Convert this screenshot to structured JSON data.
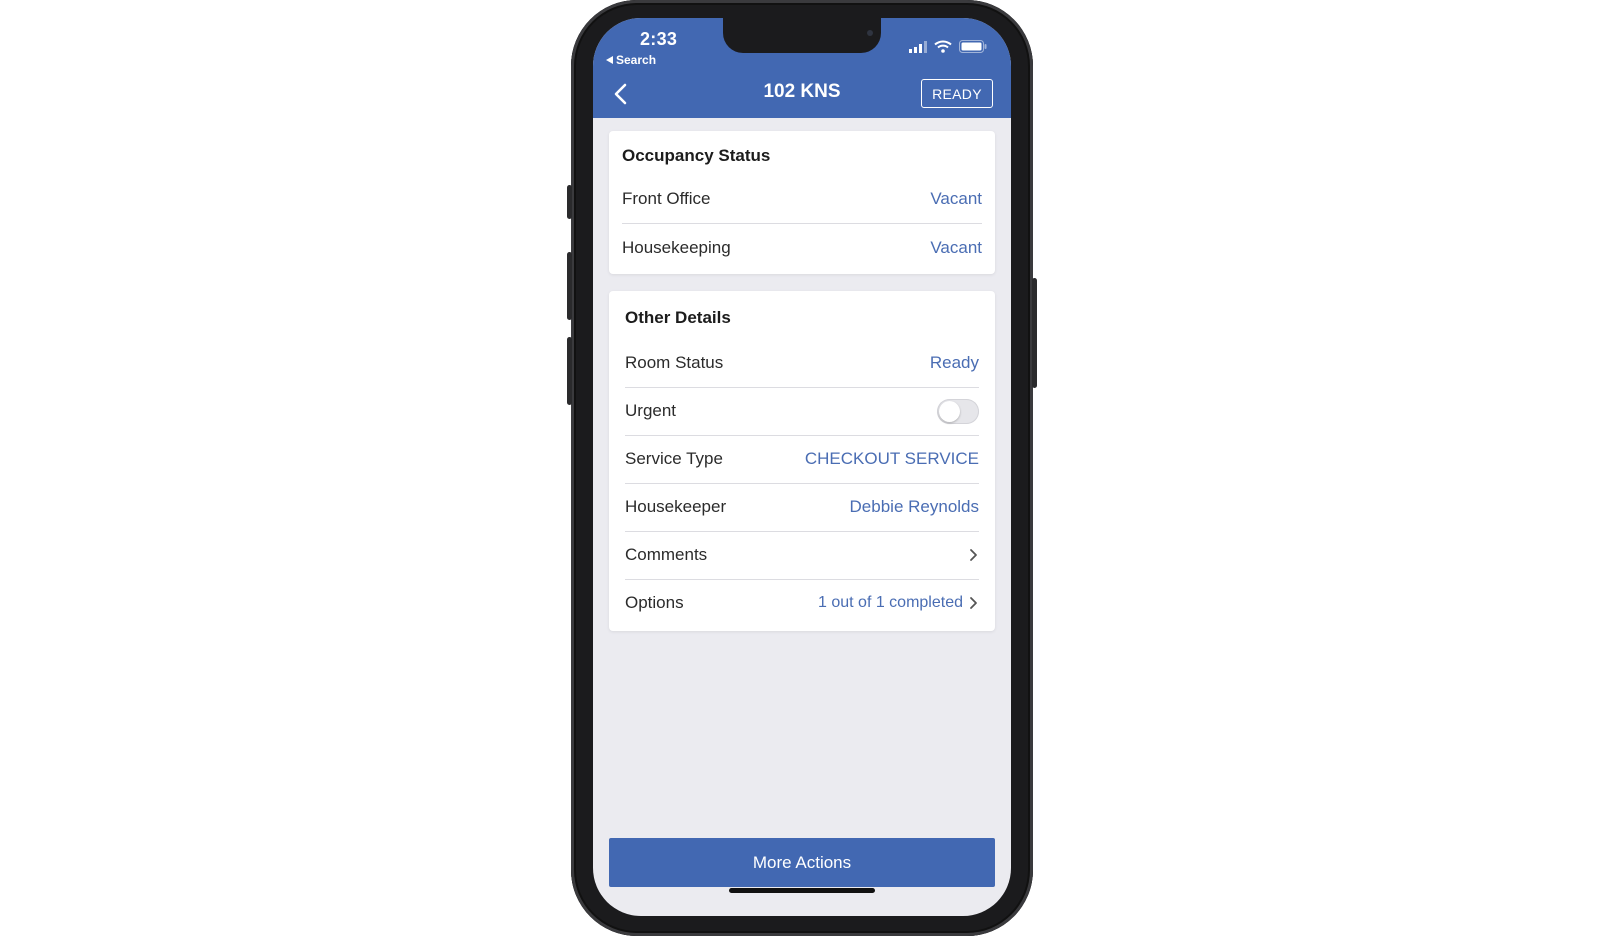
{
  "status_bar": {
    "time": "2:33",
    "back_app": "Search"
  },
  "nav": {
    "title": "102 KNS",
    "ready_button": "READY"
  },
  "occupancy": {
    "title": "Occupancy Status",
    "rows": [
      {
        "label": "Front Office",
        "value": "Vacant"
      },
      {
        "label": "Housekeeping",
        "value": "Vacant"
      }
    ]
  },
  "details": {
    "title": "Other Details",
    "room_status": {
      "label": "Room Status",
      "value": "Ready"
    },
    "urgent": {
      "label": "Urgent",
      "on": false
    },
    "service_type": {
      "label": "Service Type",
      "value": "CHECKOUT SERVICE"
    },
    "housekeeper": {
      "label": "Housekeeper",
      "value": "Debbie Reynolds"
    },
    "comments": {
      "label": "Comments"
    },
    "options": {
      "label": "Options",
      "value": "1 out of 1 completed"
    }
  },
  "more_actions": "More Actions",
  "colors": {
    "brand": "#4268b2",
    "link": "#4a6db3",
    "background": "#ebebf0"
  },
  "icons": [
    "back-chevron-icon",
    "signal-icon",
    "wifi-icon",
    "battery-icon",
    "chevron-right-icon"
  ]
}
